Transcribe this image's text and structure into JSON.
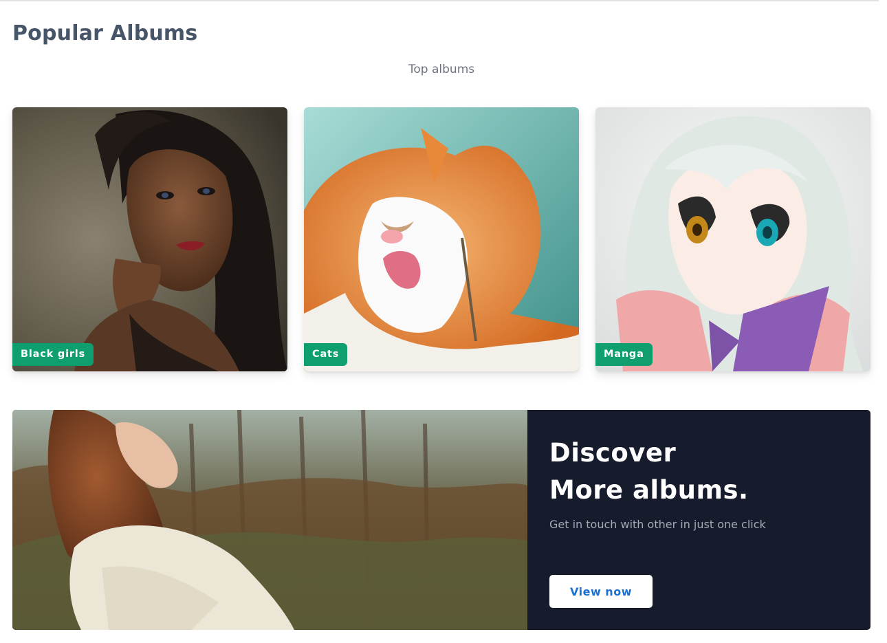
{
  "section": {
    "title": "Popular Albums",
    "subtitle": "Top albums"
  },
  "albums": [
    {
      "label": "Black girls",
      "image": "portrait-woman-dark-hair"
    },
    {
      "label": "Cats",
      "image": "orange-cat-licking"
    },
    {
      "label": "Manga",
      "image": "anime-girl-silver-hair"
    }
  ],
  "promo": {
    "headline_line1": "Discover",
    "headline_line2": "More albums.",
    "description": "Get in touch with other in just one click",
    "button_label": "View now",
    "image": "woman-in-forest"
  },
  "colors": {
    "badge": "#0f9f6e",
    "promo_bg": "#171c2c",
    "button_text": "#1b6fd1",
    "title": "#475569"
  }
}
